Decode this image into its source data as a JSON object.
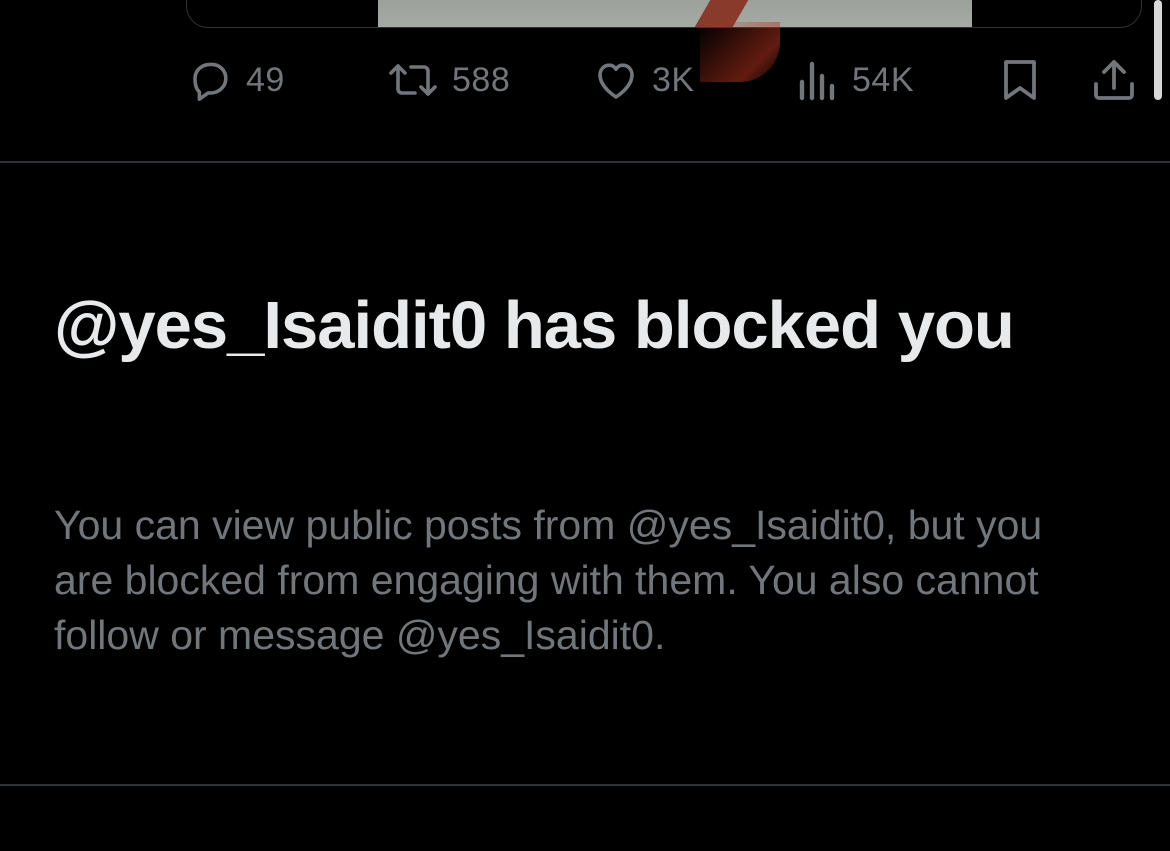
{
  "post": {
    "actions": {
      "replies": "49",
      "reposts": "588",
      "likes": "3K",
      "views": "54K"
    },
    "icons": {
      "reply": "reply-icon",
      "repost": "repost-icon",
      "like": "heart-icon",
      "views": "views-chart-icon",
      "bookmark": "bookmark-icon",
      "share": "share-icon"
    }
  },
  "blocked_notice": {
    "title": "@yes_Isaidit0 has blocked you",
    "description": "You can view public posts from @yes_Isaidit0, but you are blocked from engaging with them. You also cannot follow or message @yes_Isaidit0."
  },
  "colors": {
    "background": "#000000",
    "primary_text": "#e7e9ea",
    "secondary_text": "#71767b",
    "divider": "#2f3336"
  }
}
